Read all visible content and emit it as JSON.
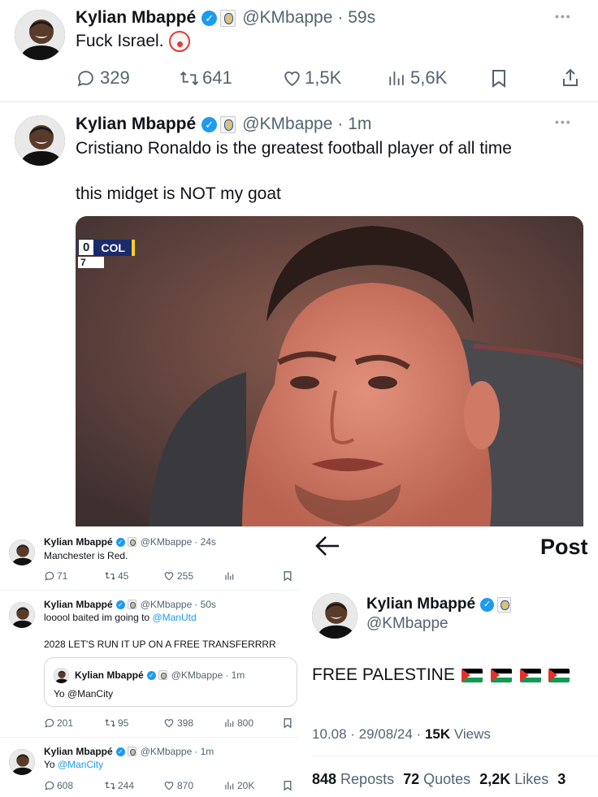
{
  "tweet1": {
    "name": "Kylian Mbappé",
    "handle": "@KMbappe",
    "time": "· 59s",
    "text": "Fuck Israel.",
    "emoji": "clown-face",
    "replies": "329",
    "reposts": "641",
    "likes": "1,5K",
    "views": "5,6K"
  },
  "tweet2": {
    "name": "Kylian Mbappé",
    "handle": "@KMbappe",
    "time": "· 1m",
    "text_line1": "Cristiano Ronaldo is the greatest football player of all time",
    "text_line2": "this midget is NOT my goat",
    "scorebug_left": "0",
    "scorebug_team": "COL",
    "scorebug_sub": "7"
  },
  "tweet3": {
    "name": "Kylian Mbappé",
    "handle": "@KMbappe",
    "time": "· 24s",
    "text": "Manchester is Red.",
    "replies": "71",
    "reposts": "45",
    "likes": "255"
  },
  "tweet4": {
    "name": "Kylian Mbappé",
    "handle": "@KMbappe",
    "time": "· 50s",
    "text_prefix": "looool baited im going to ",
    "text_link": "@ManUtd",
    "text_line2": "2028 LET'S RUN IT UP ON A FREE TRANSFERRRR",
    "quote": {
      "name": "Kylian Mbappé",
      "handle": "@KMbappe",
      "time": "· 1m",
      "text": "Yo @ManCity"
    },
    "replies": "201",
    "reposts": "95",
    "likes": "398",
    "views": "800"
  },
  "tweet5": {
    "name": "Kylian Mbappé",
    "handle": "@KMbappe",
    "time": "· 1m",
    "text_prefix": "Yo ",
    "text_link": "@ManCity",
    "replies": "608",
    "reposts": "244",
    "likes": "870",
    "views": "20K"
  },
  "post_detail": {
    "header_title": "Post",
    "name": "Kylian Mbappé",
    "handle": "@KMbappe",
    "text": "FREE PALESTINE",
    "flag_count": 4,
    "timestamp": "10.08 · 29/08/24 · ",
    "views_count": "15K",
    "views_label": " Views",
    "reposts_count": "848",
    "reposts_label": " Reposts",
    "quotes_count": "72",
    "quotes_label": " Quotes",
    "likes_count": "2,2K",
    "likes_label": " Likes",
    "cut_char": "3"
  },
  "colors": {
    "verified": "#1d9bf0",
    "muted": "#536471",
    "link": "#1d9bf0",
    "divider": "#eff3f4"
  }
}
